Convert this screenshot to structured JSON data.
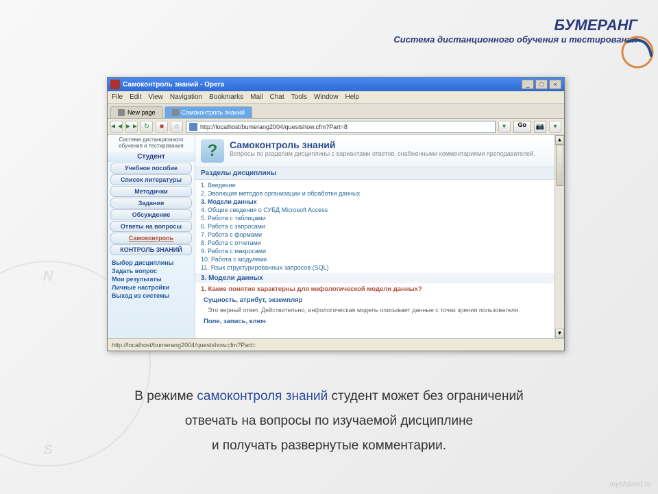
{
  "header": {
    "title": "БУМЕРАНГ",
    "subtitle": "Система дистанционного обучения и тестирования"
  },
  "watermark": "myshared.ru",
  "browser": {
    "title": "Самоконтроль знаний - Opera",
    "menu": [
      "File",
      "Edit",
      "View",
      "Navigation",
      "Bookmarks",
      "Mail",
      "Chat",
      "Tools",
      "Window",
      "Help"
    ],
    "tabs": [
      {
        "label": "New page",
        "active": false
      },
      {
        "label": "Самоконтроль знаний",
        "active": true
      }
    ],
    "url": "http://localhost/bumerang2004/questshow.cfm?Part=8",
    "go": "Go",
    "status": "http://localhost/bumerang2004/questshow.cfm?Part="
  },
  "sidebar": {
    "header": "Система дистанционного обучения и тестирования",
    "section": "Студент",
    "buttons": [
      "Учебное пособие",
      "Список литературы",
      "Методички",
      "Задания",
      "Обсуждение",
      "Ответы на вопросы",
      "Самоконтроль",
      "КОНТРОЛЬ ЗНАНИЙ"
    ],
    "links": [
      "Выбор дисциплины",
      "Задать вопрос",
      "Мои результаты",
      "Личные настройки",
      "Выход из системы"
    ]
  },
  "main": {
    "title": "Самоконтроль знаний",
    "subtitle": "Вопросы по разделам дисциплины с вариантами ответов, снабженными комментариями преподавателей.",
    "section_header": "Разделы дисциплины",
    "topics": [
      "1. Введение",
      "2. Эволюция методов организации и обработки данных",
      "3. Модели данных",
      "4. Общие сведения о СУБД Microsoft Access",
      "5. Работа с таблицами",
      "6. Работа с запросами",
      "7. Работа с формами",
      "8. Работа с отчетами",
      "9. Работа с макросами",
      "10. Работа с модулями",
      "11. Язык структурированных запросов (SQL)"
    ],
    "selected_topic": "3. Модели данных",
    "question": "1. Какие понятия характерны для инфологической модели данных?",
    "answer1": "Сущность, атрибут, экземпляр",
    "feedback": "Это верный ответ. Действительно, инфологическая модель описывает данные с точки зрения пользователя.",
    "answer2": "Поле, запись, ключ"
  },
  "bottom": {
    "l1a": "В режиме ",
    "l1b": "самоконтроля знаний ",
    "l1c": "студент может без ограничений",
    "l2": "отвечать на вопросы по изучаемой дисциплине",
    "l3": "и получать развернутые комментарии."
  }
}
